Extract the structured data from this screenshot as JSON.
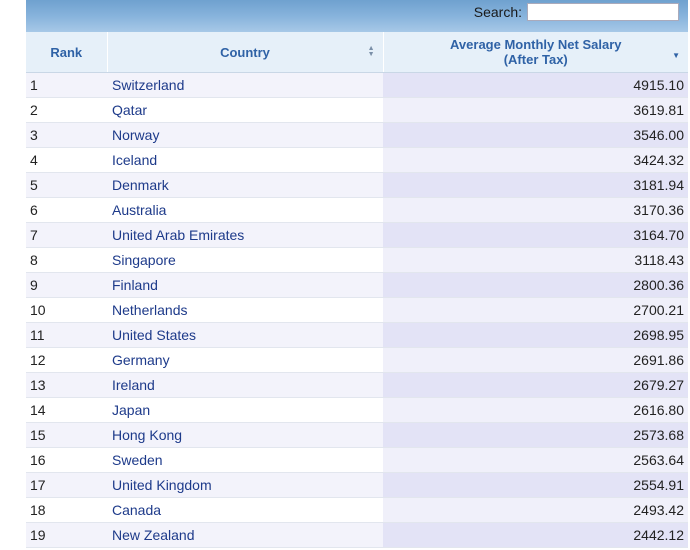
{
  "search": {
    "label": "Search:",
    "value": ""
  },
  "table": {
    "headers": {
      "rank": "Rank",
      "country": "Country",
      "salary_line1": "Average Monthly Net Salary",
      "salary_line2": "(After Tax)"
    },
    "rows": [
      {
        "rank": "1",
        "country": "Switzerland",
        "salary": "4915.10"
      },
      {
        "rank": "2",
        "country": "Qatar",
        "salary": "3619.81"
      },
      {
        "rank": "3",
        "country": "Norway",
        "salary": "3546.00"
      },
      {
        "rank": "4",
        "country": "Iceland",
        "salary": "3424.32"
      },
      {
        "rank": "5",
        "country": "Denmark",
        "salary": "3181.94"
      },
      {
        "rank": "6",
        "country": "Australia",
        "salary": "3170.36"
      },
      {
        "rank": "7",
        "country": "United Arab Emirates",
        "salary": "3164.70"
      },
      {
        "rank": "8",
        "country": "Singapore",
        "salary": "3118.43"
      },
      {
        "rank": "9",
        "country": "Finland",
        "salary": "2800.36"
      },
      {
        "rank": "10",
        "country": "Netherlands",
        "salary": "2700.21"
      },
      {
        "rank": "11",
        "country": "United States",
        "salary": "2698.95"
      },
      {
        "rank": "12",
        "country": "Germany",
        "salary": "2691.86"
      },
      {
        "rank": "13",
        "country": "Ireland",
        "salary": "2679.27"
      },
      {
        "rank": "14",
        "country": "Japan",
        "salary": "2616.80"
      },
      {
        "rank": "15",
        "country": "Hong Kong",
        "salary": "2573.68"
      },
      {
        "rank": "16",
        "country": "Sweden",
        "salary": "2563.64"
      },
      {
        "rank": "17",
        "country": "United Kingdom",
        "salary": "2554.91"
      },
      {
        "rank": "18",
        "country": "Canada",
        "salary": "2493.42"
      },
      {
        "rank": "19",
        "country": "New Zealand",
        "salary": "2442.12"
      }
    ]
  },
  "icons": {
    "country_sort": "sort-both-icon",
    "salary_sort": "sort-descending-icon"
  }
}
